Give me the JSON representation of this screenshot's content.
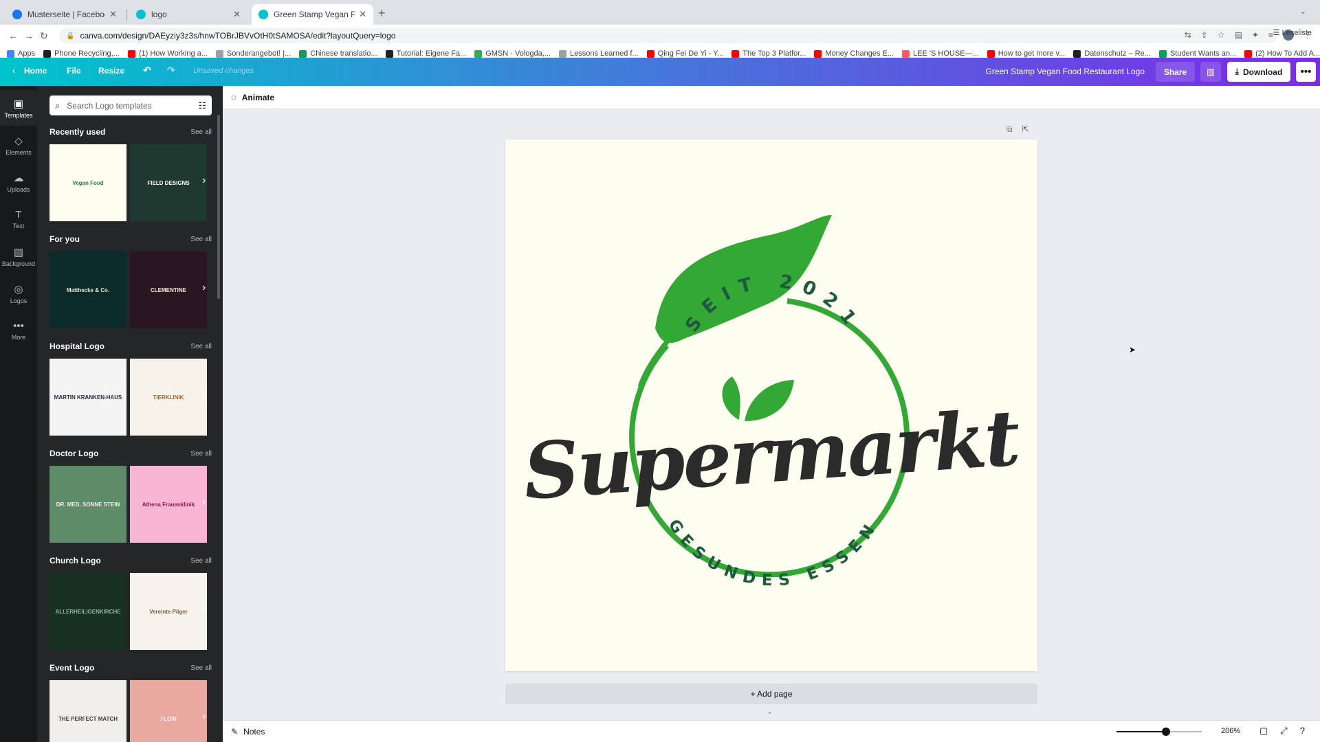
{
  "browser": {
    "tabs": [
      {
        "title": "Musterseite | Facebook",
        "favicon_color": "#1877f2",
        "active": false
      },
      {
        "title": "logo",
        "favicon_color": "#00c4cc",
        "active": false
      },
      {
        "title": "Green Stamp Vegan Food Rest",
        "favicon_color": "#00c4cc",
        "active": true
      }
    ],
    "new_tab_icon": "+",
    "url": "canva.com/design/DAEyziy3z3s/hnwTOBrJBVvOtH0tSAMOSA/edit?layoutQuery=logo",
    "bookmarks": [
      {
        "label": "Apps",
        "color": "#4285f4"
      },
      {
        "label": "Phone Recycling,...",
        "color": "#202124"
      },
      {
        "label": "(1) How Working a...",
        "color": "#ff0000"
      },
      {
        "label": "Sonderangebot! |...",
        "color": "#9aa0a6"
      },
      {
        "label": "Chinese translatio...",
        "color": "#0f9d58"
      },
      {
        "label": "Tutorial: Eigene Fa...",
        "color": "#202124"
      },
      {
        "label": "GMSN - Vologda,...",
        "color": "#34a853"
      },
      {
        "label": "Lessons Learned f...",
        "color": "#9aa0a6"
      },
      {
        "label": "Qing Fei De Yi - Y...",
        "color": "#ff0000"
      },
      {
        "label": "The Top 3 Platfor...",
        "color": "#ff0000"
      },
      {
        "label": "Money Changes E...",
        "color": "#ff0000"
      },
      {
        "label": "LEE 'S HOUSE—...",
        "color": "#ff5a5f"
      },
      {
        "label": "How to get more v...",
        "color": "#ff0000"
      },
      {
        "label": "Datenschutz – Re...",
        "color": "#202124"
      },
      {
        "label": "Student Wants an...",
        "color": "#0f9d58"
      },
      {
        "label": "(2) How To Add A...",
        "color": "#ff0000"
      }
    ],
    "reading_list": "Leseliste"
  },
  "header": {
    "home": "Home",
    "file": "File",
    "resize": "Resize",
    "unsaved": "Unsaved changes",
    "doc_title": "Green Stamp Vegan Food Restaurant Logo",
    "share": "Share",
    "download": "Download"
  },
  "rail": [
    {
      "label": "Templates",
      "icon": "templates-icon",
      "glyph": "▣"
    },
    {
      "label": "Elements",
      "icon": "elements-icon",
      "glyph": "◇"
    },
    {
      "label": "Uploads",
      "icon": "uploads-icon",
      "glyph": "☁"
    },
    {
      "label": "Text",
      "icon": "text-icon",
      "glyph": "T"
    },
    {
      "label": "Background",
      "icon": "background-icon",
      "glyph": "▨"
    },
    {
      "label": "Logos",
      "icon": "logos-icon",
      "glyph": "◎"
    },
    {
      "label": "More",
      "icon": "more-icon",
      "glyph": "•••"
    }
  ],
  "panel": {
    "search_placeholder": "Search Logo templates",
    "see_all": "See all",
    "sections": [
      {
        "title": "Recently used",
        "thumbs": [
          {
            "text": "Vegan Food",
            "bg": "#fdfdf0",
            "fg": "#2e7d32"
          },
          {
            "text": "FIELD DESIGNS",
            "bg": "#1e3a30",
            "fg": "#ffffff"
          }
        ]
      },
      {
        "title": "For you",
        "thumbs": [
          {
            "text": "Matthecke & Co.",
            "bg": "#0b2a2a",
            "fg": "#e8e2c8"
          },
          {
            "text": "CLEMENTINE",
            "bg": "#2a1620",
            "fg": "#f4e9d8"
          }
        ]
      },
      {
        "title": "Hospital Logo",
        "thumbs": [
          {
            "text": "MARTIN KRANKEN-HAUS",
            "bg": "#f4f4f4",
            "fg": "#2a2a4a"
          },
          {
            "text": "TIERKLINIK",
            "bg": "#f7f3ea",
            "fg": "#9a6a3a"
          }
        ]
      },
      {
        "title": "Doctor Logo",
        "thumbs": [
          {
            "text": "DR. MED. SONNE STEIN",
            "bg": "#5e8b68",
            "fg": "#f0f0e8"
          },
          {
            "text": "Athena Frauenklinik",
            "bg": "#f9b6d4",
            "fg": "#8e1a4a"
          }
        ]
      },
      {
        "title": "Church Logo",
        "thumbs": [
          {
            "text": "ALLERHEILIGENKIRCHE",
            "bg": "#18301f",
            "fg": "#8fb39a"
          },
          {
            "text": "Vereinte Pilger",
            "bg": "#f6f3ec",
            "fg": "#8a5a3a"
          }
        ]
      },
      {
        "title": "Event Logo",
        "thumbs": [
          {
            "text": "THE PERFECT MATCH",
            "bg": "#f1efe9",
            "fg": "#3a3a3a"
          },
          {
            "text": "FLOW",
            "bg": "#e9a9a0",
            "fg": "#fff2ee"
          }
        ]
      }
    ]
  },
  "workspace": {
    "animate": "Animate",
    "add_page": "+ Add page",
    "notes": "Notes",
    "zoom": "206%",
    "zoom_level": 0.58
  },
  "logo": {
    "top_text": "SEIT 2021",
    "main_text": "Supermarkt",
    "bottom_text": "GESUNDES ESSEN",
    "green": "#34a835",
    "dark_green": "#1f5a3e",
    "text_color": "#2b2b2b"
  }
}
